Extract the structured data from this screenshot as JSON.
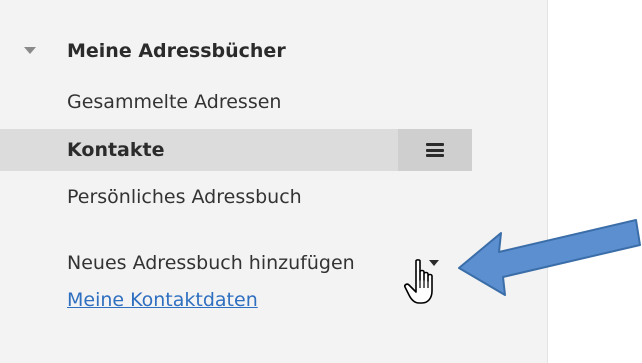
{
  "colors": {
    "panel_bg": "#f3f3f3",
    "selected_bg": "#dcdcdc",
    "menu_button_bg": "#cfcfcf",
    "link": "#2f6fc0",
    "arrow_fill": "#5b8fd0",
    "arrow_stroke": "#3b6ea8"
  },
  "addressbooks": {
    "group_title": "Meine Adressbücher",
    "group_expanded": true,
    "items": [
      {
        "label": "Gesammelte Adressen",
        "selected": false
      },
      {
        "label": "Kontakte",
        "selected": true,
        "menu_icon": "hamburger-menu-icon"
      },
      {
        "label": "Persönliches Adressbuch",
        "selected": false
      }
    ]
  },
  "actions": {
    "add_label": "Neues Adressbuch hinzufügen",
    "add_icon": "dropdown-caret-icon",
    "my_contact_label": "Meine Kontaktdaten"
  },
  "overlay": {
    "cursor_icon": "hand-pointer-icon",
    "annotation_icon": "blue-arrow-icon"
  }
}
